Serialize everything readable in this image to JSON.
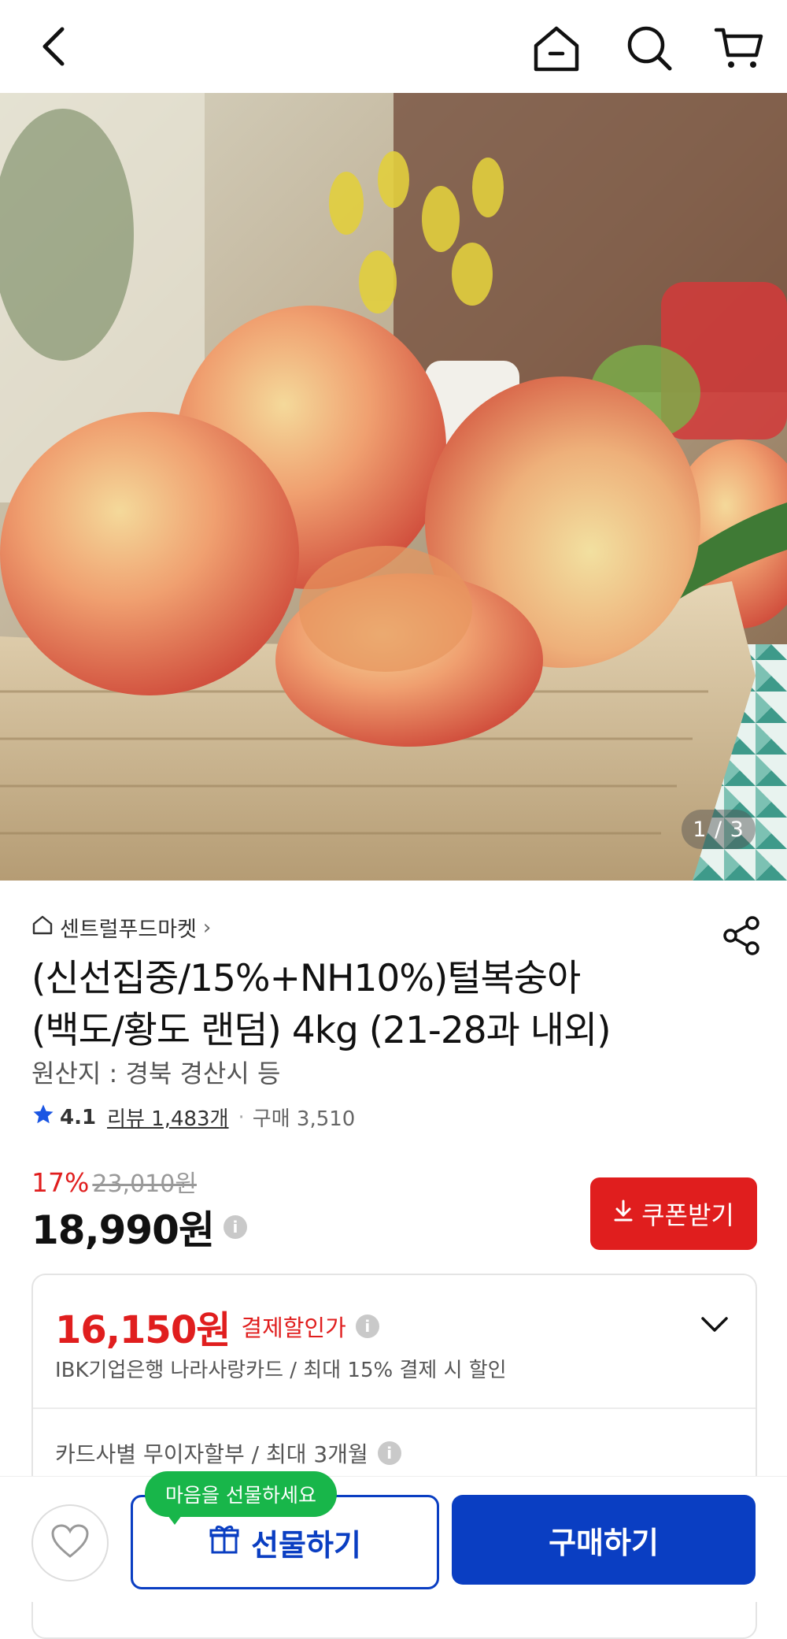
{
  "header": {
    "back_icon": "back-arrow-icon",
    "home_icon": "home-icon",
    "search_icon": "search-icon",
    "cart_icon": "cart-icon"
  },
  "gallery": {
    "current": "1",
    "total": "3",
    "counter_text": "1 / 3"
  },
  "product": {
    "store_name": "센트럴푸드마켓",
    "title_line1": "(신선집중/15%+NH10%)털복숭아",
    "title_line2": "(백도/황도 랜덤) 4kg (21-28과 내외)",
    "origin": "원산지 : 경북 경산시 등",
    "rating": "4.1",
    "review_text": "리뷰 1,483개",
    "purchase_text": "구매 3,510",
    "discount_rate": "17%",
    "original_price": "23,010원",
    "price": "18,990원",
    "info_glyph": "i",
    "coupon_label": "쿠폰받기"
  },
  "card_discount": {
    "price": "16,150원",
    "label": "결제할인가",
    "info_glyph": "i",
    "description": "IBK기업은행 나라사랑카드 / 최대 15% 결제 시 할인",
    "installment": "카드사별 무이자할부 / 최대 3개월"
  },
  "bottom": {
    "gift_bubble": "마음을 선물하세요",
    "gift_label": "선물하기",
    "buy_label": "구매하기"
  },
  "colors": {
    "brand_blue": "#0a3ec2",
    "sale_red": "#e01e1e",
    "bubble_green": "#18b64a"
  }
}
